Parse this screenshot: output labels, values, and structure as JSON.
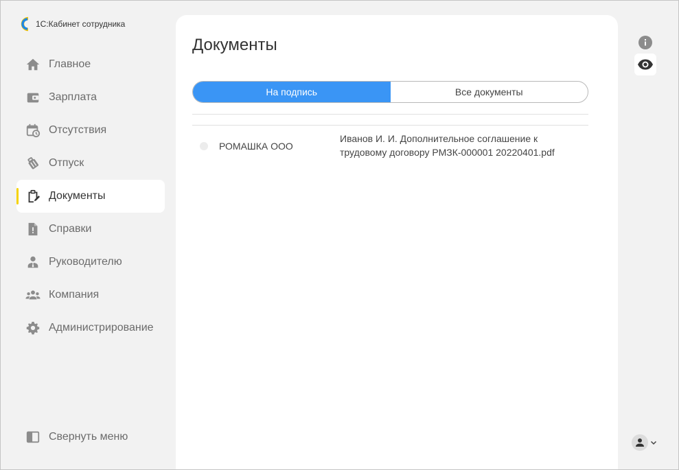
{
  "app": {
    "name": "1С:Кабинет сотрудника"
  },
  "nav": {
    "items": [
      {
        "label": "Главное",
        "icon": "home-icon"
      },
      {
        "label": "Зарплата",
        "icon": "wallet-icon"
      },
      {
        "label": "Отсутствия",
        "icon": "calendar-clock-icon"
      },
      {
        "label": "Отпуск",
        "icon": "luggage-icon"
      },
      {
        "label": "Документы",
        "icon": "clipboard-edit-icon",
        "active": true
      },
      {
        "label": "Справки",
        "icon": "document-alert-icon"
      },
      {
        "label": "Руководителю",
        "icon": "manager-icon"
      },
      {
        "label": "Компания",
        "icon": "group-icon"
      },
      {
        "label": "Администрирование",
        "icon": "gear-icon"
      }
    ],
    "collapse_label": "Свернуть меню"
  },
  "main": {
    "title": "Документы",
    "tabs": [
      {
        "label": "На подпись",
        "active": true
      },
      {
        "label": "Все документы",
        "active": false
      }
    ],
    "documents": [
      {
        "organization": "РОМАШКА ООО",
        "name": "Иванов И. И. Дополнительное соглашение к трудовому договору РМЗК-000001 20220401.pdf"
      }
    ]
  },
  "rail": {
    "info_icon": "info-icon",
    "view_icon": "eye-icon",
    "user_icon": "user-icon"
  },
  "colors": {
    "accent": "#3a95f5",
    "active_marker": "#f5d300",
    "sidebar_bg": "#f2f2f2",
    "panel_bg": "#ffffff",
    "icon_gray": "#8c8c8c"
  }
}
